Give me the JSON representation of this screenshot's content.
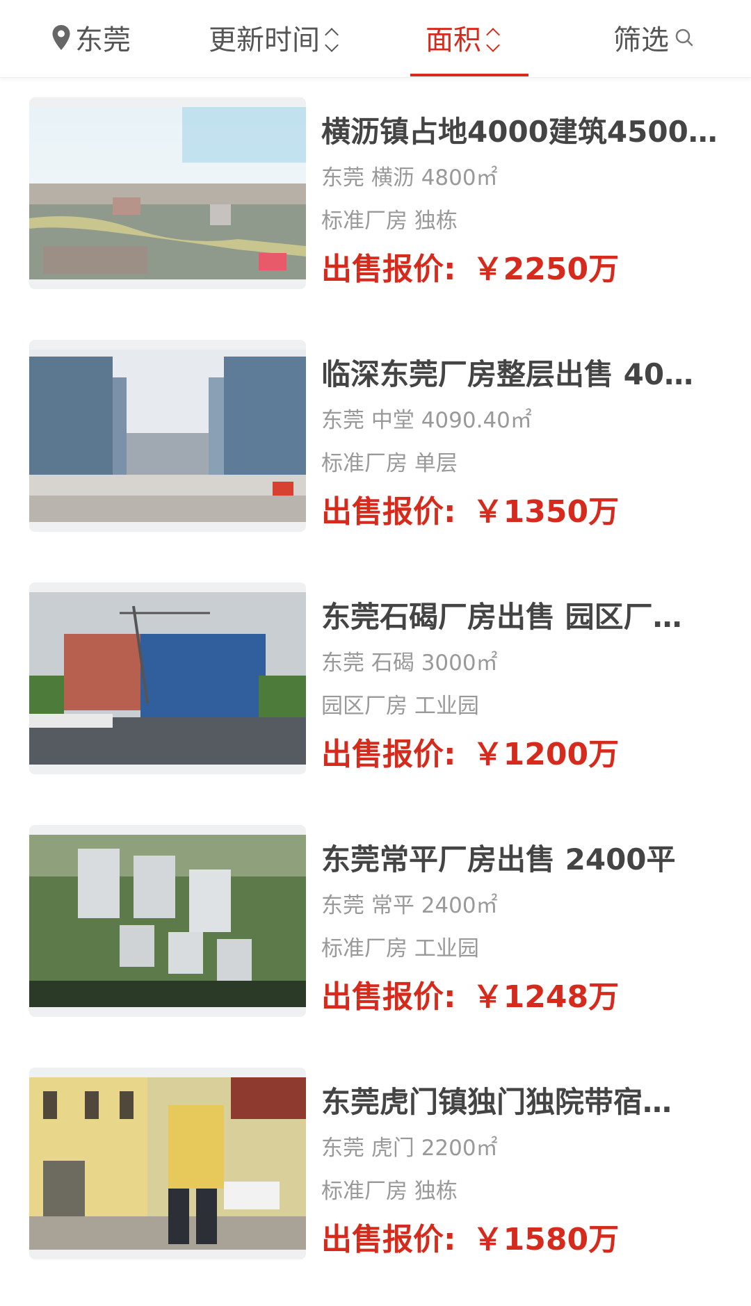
{
  "filters": {
    "location": "东莞",
    "update_time": "更新时间",
    "area": "面积",
    "filter": "筛选"
  },
  "colors": {
    "accent": "#d62b1c",
    "text_secondary": "#999999",
    "title": "#444444"
  },
  "listings": [
    {
      "title": "横沥镇占地4000建筑4500…",
      "meta": "东莞 横沥 4800㎡",
      "tags": "标准厂房 独栋",
      "price_label": "出售报价:",
      "price": "￥2250万"
    },
    {
      "title": "临深东莞厂房整层出售 40…",
      "meta": "东莞 中堂 4090.40㎡",
      "tags": "标准厂房 单层",
      "price_label": "出售报价:",
      "price": "￥1350万"
    },
    {
      "title": "东莞石碣厂房出售 园区厂…",
      "meta": "东莞 石碣 3000㎡",
      "tags": "园区厂房 工业园",
      "price_label": "出售报价:",
      "price": "￥1200万"
    },
    {
      "title": "东莞常平厂房出售 2400平",
      "meta": "东莞 常平 2400㎡",
      "tags": "标准厂房 工业园",
      "price_label": "出售报价:",
      "price": "￥1248万"
    },
    {
      "title": "东莞虎门镇独门独院带宿…",
      "meta": "东莞 虎门 2200㎡",
      "tags": "标准厂房 独栋",
      "price_label": "出售报价:",
      "price": "￥1580万"
    }
  ]
}
